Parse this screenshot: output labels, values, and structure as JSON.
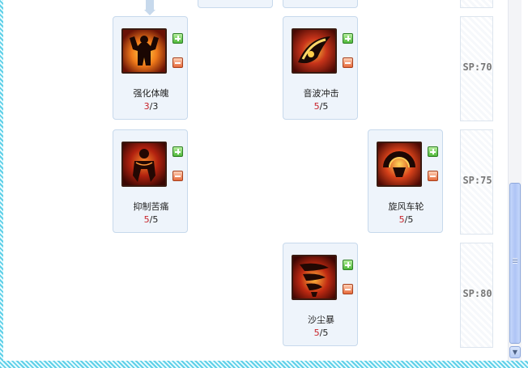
{
  "skills": [
    {
      "name": "强化体魄",
      "current": "3",
      "max": "3"
    },
    {
      "name": "音波冲击",
      "current": "5",
      "max": "5"
    },
    {
      "name": "抑制苦痛",
      "current": "5",
      "max": "5"
    },
    {
      "name": "旋风车轮",
      "current": "5",
      "max": "5"
    },
    {
      "name": "沙尘暴",
      "current": "5",
      "max": "5"
    }
  ],
  "sp_rows": [
    "SP:70",
    "SP:75",
    "SP:80"
  ],
  "level_separator": "/",
  "colors": {
    "card_bg": "#eef4fb",
    "card_border": "#c7d9ec",
    "current_level": "#c8222a",
    "plus_button": "#4fb83a",
    "minus_button": "#e66a3a",
    "frame": "#5fd0e8",
    "scroll_thumb": "#aec4f5"
  },
  "icons": {
    "plus": "plus-icon",
    "minus": "minus-icon",
    "scroll_down": "chevron-down-icon"
  }
}
